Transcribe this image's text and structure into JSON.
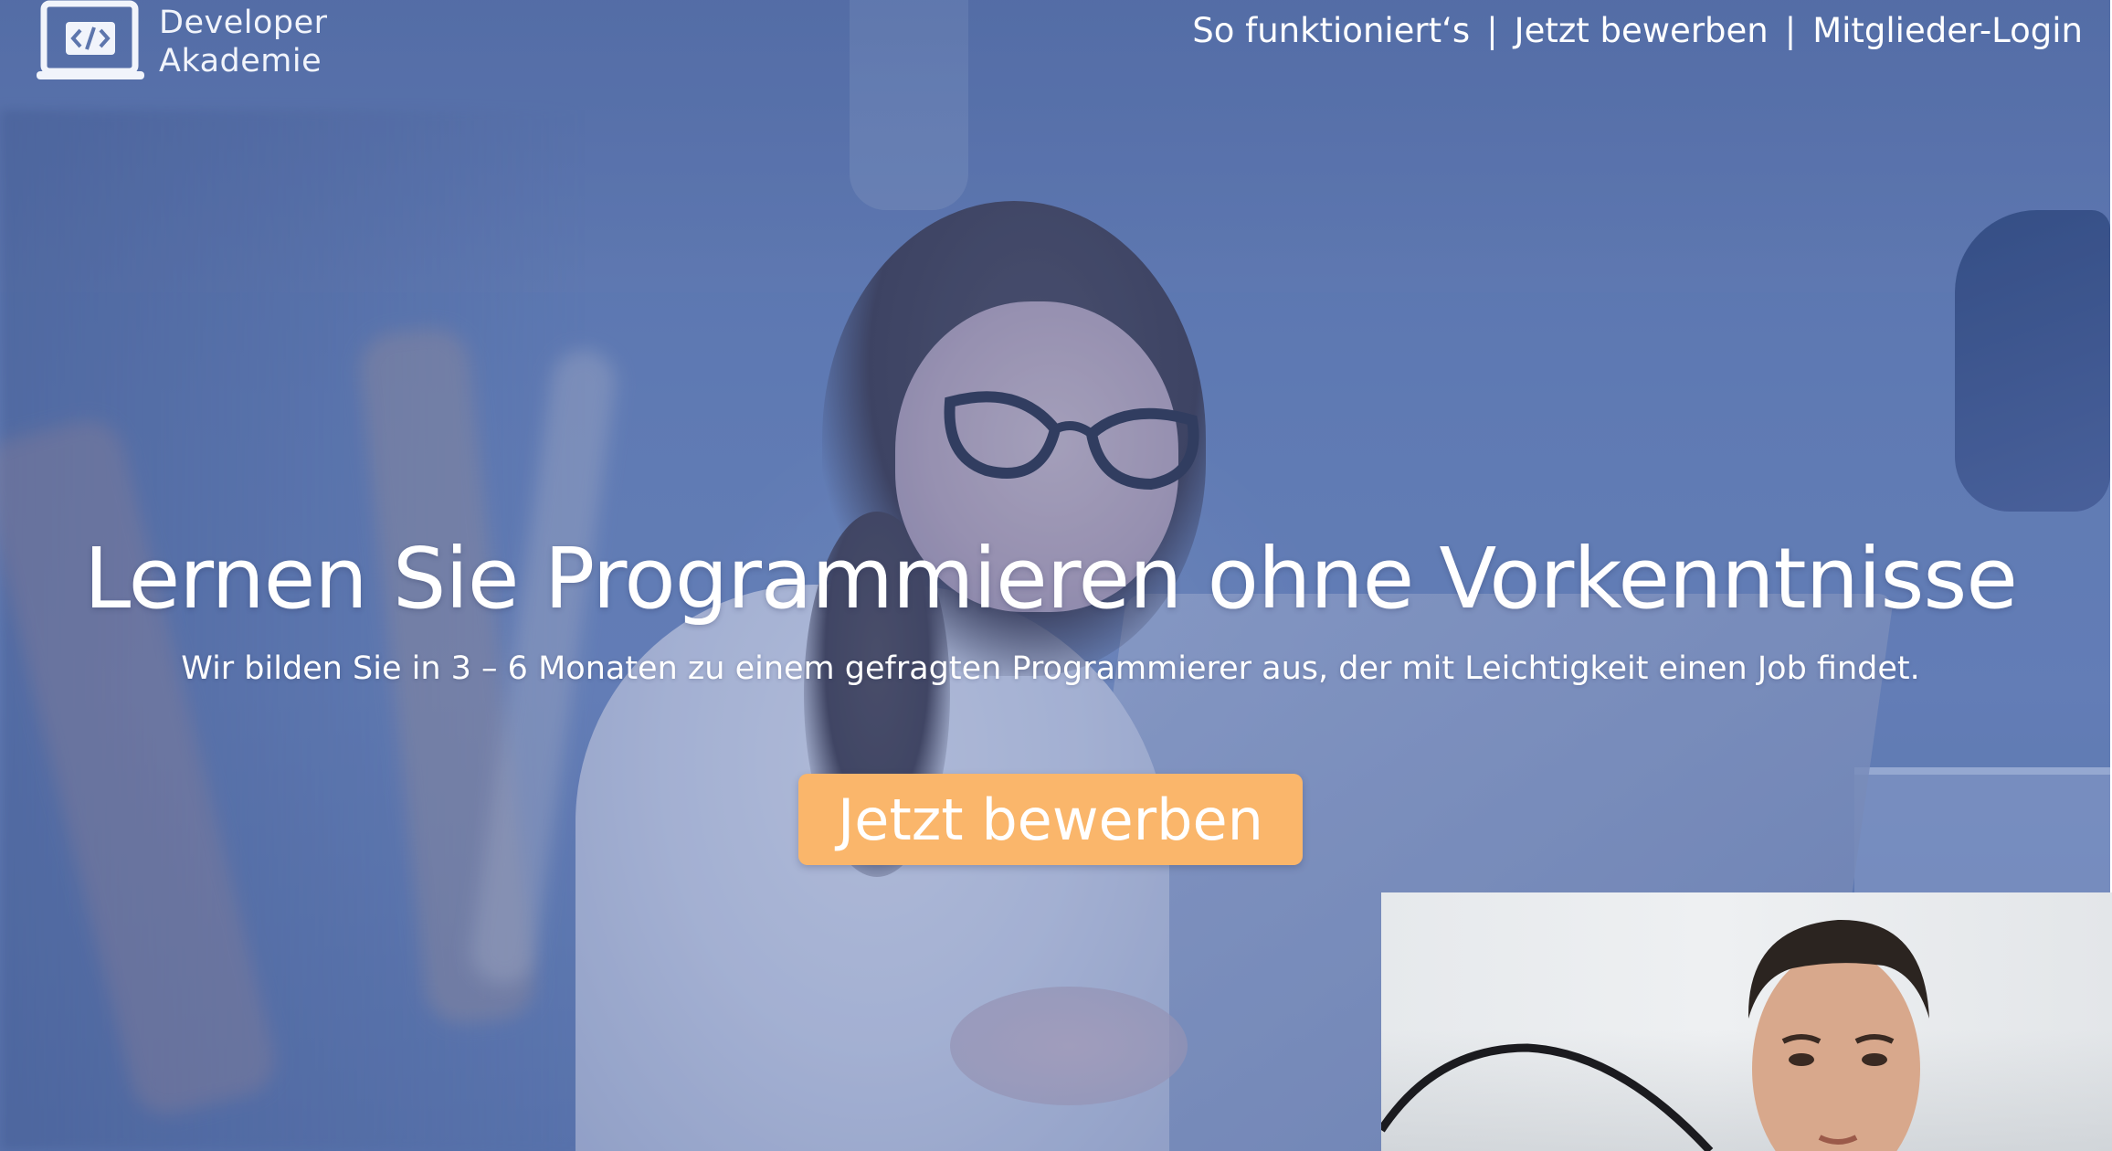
{
  "logo": {
    "icon": "code-laptop-icon",
    "line1": "Developer",
    "line2": "Akademie"
  },
  "nav": {
    "items": [
      {
        "label": "So funktioniert‘s"
      },
      {
        "label": "Jetzt bewerben"
      },
      {
        "label": "Mitglieder-Login"
      }
    ],
    "separator": "|"
  },
  "hero": {
    "headline": "Lernen Sie Programmieren ohne Vorkenntnisse",
    "subline": "Wir bilden Sie in 3 – 6 Monaten zu einem gefragten Programmierer aus, der mit Leichtigkeit einen Job findet.",
    "cta_label": "Jetzt bewerben"
  },
  "colors": {
    "overlay_blue": "#5d76ad",
    "cta_orange": "#fab66b",
    "text": "#ffffff"
  }
}
